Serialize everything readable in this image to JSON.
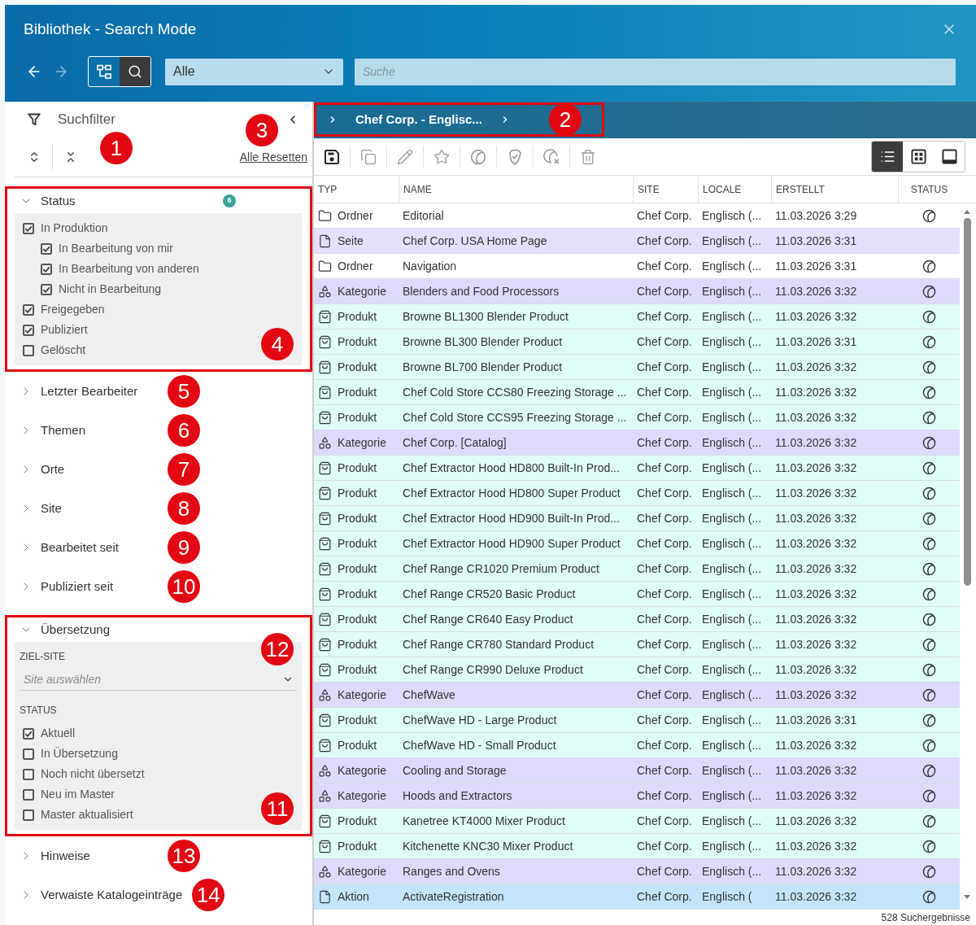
{
  "window": {
    "title": "Bibliothek - Search Mode"
  },
  "header": {
    "nav": [
      {
        "kind": "back",
        "disabled": false
      },
      {
        "kind": "forward",
        "disabled": true
      }
    ],
    "modes": [
      {
        "kind": "tree",
        "selected": false
      },
      {
        "kind": "search",
        "selected": true
      }
    ],
    "scope": {
      "value": "Alle"
    },
    "search": {
      "placeholder": "Suche"
    }
  },
  "filter_panel": {
    "title": "Suchfilter",
    "tools_callout": "1",
    "reset_link": "Alle Resetten",
    "reset_callout": "3",
    "sections": [
      {
        "title": "Status",
        "expanded": true,
        "highlighted": true,
        "badge": "6",
        "callout": "4",
        "options": [
          {
            "label": "In Produktion",
            "checked": true,
            "children": [
              {
                "label": "In Bearbeitung von mir",
                "checked": true
              },
              {
                "label": "In Bearbeitung von anderen",
                "checked": true
              },
              {
                "label": "Nicht in Bearbeitung",
                "checked": true
              }
            ]
          },
          {
            "label": "Freigegeben",
            "checked": true
          },
          {
            "label": "Publiziert",
            "checked": true
          },
          {
            "label": "Gelöscht",
            "checked": false
          }
        ]
      },
      {
        "title": "Letzter Bearbeiter",
        "expanded": false,
        "highlighted": false,
        "callout": "5"
      },
      {
        "title": "Themen",
        "expanded": false,
        "highlighted": false,
        "callout": "6"
      },
      {
        "title": "Orte",
        "expanded": false,
        "highlighted": false,
        "callout": "7"
      },
      {
        "title": "Site",
        "expanded": false,
        "highlighted": false,
        "callout": "8"
      },
      {
        "title": "Bearbeitet seit",
        "expanded": false,
        "highlighted": false,
        "callout": "9"
      },
      {
        "title": "Publiziert seit",
        "expanded": false,
        "highlighted": false,
        "callout": "10"
      },
      {
        "title": "Übersetzung",
        "expanded": true,
        "highlighted": true,
        "target_site": {
          "label": "ZIEL-SITE",
          "placeholder": "Site auswählen",
          "callout": "12"
        },
        "status_label": "STATUS",
        "callout": "11",
        "options": [
          {
            "label": "Aktuell",
            "checked": true
          },
          {
            "label": "In Übersetzung",
            "checked": false
          },
          {
            "label": "Noch nicht übersetzt",
            "checked": false
          },
          {
            "label": "Neu im Master",
            "checked": false
          },
          {
            "label": "Master aktualisiert",
            "checked": false
          }
        ]
      },
      {
        "title": "Hinweise",
        "expanded": false,
        "highlighted": false,
        "callout": "13"
      },
      {
        "title": "Verwaiste Katalogeinträge",
        "expanded": false,
        "highlighted": false,
        "callout": "14"
      }
    ]
  },
  "breadcrumb": {
    "items": [
      "Chef Corp. - Englisc..."
    ],
    "highlighted": true,
    "callout": "2"
  },
  "item_toolbar": {
    "actions": [
      {
        "kind": "save",
        "disabled": false
      },
      {
        "kind": "copy",
        "disabled": true
      },
      {
        "kind": "edit",
        "disabled": true
      },
      {
        "kind": "favorite",
        "disabled": true
      },
      {
        "kind": "publish",
        "disabled": true
      },
      {
        "kind": "approve",
        "disabled": true
      },
      {
        "kind": "withdraw",
        "disabled": true
      },
      {
        "kind": "delete",
        "disabled": true
      }
    ],
    "views": [
      {
        "kind": "list",
        "selected": true
      },
      {
        "kind": "grid",
        "selected": false
      },
      {
        "kind": "preview",
        "selected": false
      }
    ]
  },
  "table": {
    "columns": [
      "TYP",
      "NAME",
      "SITE",
      "LOCALE",
      "ERSTELLT",
      "STATUS"
    ],
    "rows": [
      {
        "kind": "folder",
        "type": "Ordner",
        "name": "Editorial",
        "site": "Chef Corp.",
        "locale": "Englisch (...",
        "created": "11.03.2026 3:29",
        "published": true
      },
      {
        "kind": "page",
        "type": "Seite",
        "name": "Chef Corp. USA Home Page",
        "site": "Chef Corp.",
        "locale": "Englisch (...",
        "created": "11.03.2026 3:31",
        "published": false
      },
      {
        "kind": "folder",
        "type": "Ordner",
        "name": "Navigation",
        "site": "Chef Corp.",
        "locale": "Englisch (...",
        "created": "11.03.2026 3:31",
        "published": true
      },
      {
        "kind": "category",
        "type": "Kategorie",
        "name": "Blenders and Food Processors",
        "site": "Chef Corp.",
        "locale": "Englisch (...",
        "created": "11.03.2026 3:32",
        "published": true
      },
      {
        "kind": "product",
        "type": "Produkt",
        "name": "Browne BL1300 Blender Product",
        "site": "Chef Corp.",
        "locale": "Englisch (...",
        "created": "11.03.2026 3:32",
        "published": true
      },
      {
        "kind": "product",
        "type": "Produkt",
        "name": "Browne BL300 Blender Product",
        "site": "Chef Corp.",
        "locale": "Englisch (...",
        "created": "11.03.2026 3:31",
        "published": true
      },
      {
        "kind": "product",
        "type": "Produkt",
        "name": "Browne BL700 Blender Product",
        "site": "Chef Corp.",
        "locale": "Englisch (...",
        "created": "11.03.2026 3:32",
        "published": true
      },
      {
        "kind": "product",
        "type": "Produkt",
        "name": "Chef Cold Store CCS80 Freezing Storage ...",
        "site": "Chef Corp.",
        "locale": "Englisch (...",
        "created": "11.03.2026 3:32",
        "published": true
      },
      {
        "kind": "product",
        "type": "Produkt",
        "name": "Chef Cold Store CCS95 Freezing Storage ...",
        "site": "Chef Corp.",
        "locale": "Englisch (...",
        "created": "11.03.2026 3:32",
        "published": true
      },
      {
        "kind": "category",
        "type": "Kategorie",
        "name": "Chef Corp. [Catalog]",
        "site": "Chef Corp.",
        "locale": "Englisch (...",
        "created": "11.03.2026 3:32",
        "published": true
      },
      {
        "kind": "product",
        "type": "Produkt",
        "name": "Chef Extractor Hood HD800 Built-In Prod...",
        "site": "Chef Corp.",
        "locale": "Englisch (...",
        "created": "11.03.2026 3:32",
        "published": true
      },
      {
        "kind": "product",
        "type": "Produkt",
        "name": "Chef Extractor Hood HD800 Super Product",
        "site": "Chef Corp.",
        "locale": "Englisch (...",
        "created": "11.03.2026 3:32",
        "published": true
      },
      {
        "kind": "product",
        "type": "Produkt",
        "name": "Chef Extractor Hood HD900 Built-In Prod...",
        "site": "Chef Corp.",
        "locale": "Englisch (...",
        "created": "11.03.2026 3:32",
        "published": true
      },
      {
        "kind": "product",
        "type": "Produkt",
        "name": "Chef Extractor Hood HD900 Super Product",
        "site": "Chef Corp.",
        "locale": "Englisch (...",
        "created": "11.03.2026 3:32",
        "published": true
      },
      {
        "kind": "product",
        "type": "Produkt",
        "name": "Chef Range CR1020 Premium Product",
        "site": "Chef Corp.",
        "locale": "Englisch (...",
        "created": "11.03.2026 3:32",
        "published": true
      },
      {
        "kind": "product",
        "type": "Produkt",
        "name": "Chef Range CR520 Basic Product",
        "site": "Chef Corp.",
        "locale": "Englisch (...",
        "created": "11.03.2026 3:32",
        "published": true
      },
      {
        "kind": "product",
        "type": "Produkt",
        "name": "Chef Range CR640 Easy Product",
        "site": "Chef Corp.",
        "locale": "Englisch (...",
        "created": "11.03.2026 3:32",
        "published": true
      },
      {
        "kind": "product",
        "type": "Produkt",
        "name": "Chef Range CR780 Standard Product",
        "site": "Chef Corp.",
        "locale": "Englisch (...",
        "created": "11.03.2026 3:32",
        "published": true
      },
      {
        "kind": "product",
        "type": "Produkt",
        "name": "Chef Range CR990 Deluxe Product",
        "site": "Chef Corp.",
        "locale": "Englisch (...",
        "created": "11.03.2026 3:32",
        "published": true
      },
      {
        "kind": "category",
        "type": "Kategorie",
        "name": "ChefWave",
        "site": "Chef Corp.",
        "locale": "Englisch (...",
        "created": "11.03.2026 3:32",
        "published": true
      },
      {
        "kind": "product",
        "type": "Produkt",
        "name": "ChefWave HD - Large Product",
        "site": "Chef Corp.",
        "locale": "Englisch (...",
        "created": "11.03.2026 3:31",
        "published": true
      },
      {
        "kind": "product",
        "type": "Produkt",
        "name": "ChefWave HD - Small Product",
        "site": "Chef Corp.",
        "locale": "Englisch (...",
        "created": "11.03.2026 3:32",
        "published": true
      },
      {
        "kind": "category",
        "type": "Kategorie",
        "name": "Cooling and Storage",
        "site": "Chef Corp.",
        "locale": "Englisch (...",
        "created": "11.03.2026 3:32",
        "published": true
      },
      {
        "kind": "category",
        "type": "Kategorie",
        "name": "Hoods and Extractors",
        "site": "Chef Corp.",
        "locale": "Englisch (...",
        "created": "11.03.2026 3:32",
        "published": true
      },
      {
        "kind": "product",
        "type": "Produkt",
        "name": "Kanetree KT4000 Mixer Product",
        "site": "Chef Corp.",
        "locale": "Englisch (...",
        "created": "11.03.2026 3:32",
        "published": true
      },
      {
        "kind": "product",
        "type": "Produkt",
        "name": "Kitchenette KNC30 Mixer Product",
        "site": "Chef Corp.",
        "locale": "Englisch (...",
        "created": "11.03.2026 3:32",
        "published": true
      },
      {
        "kind": "category",
        "type": "Kategorie",
        "name": "Ranges and Ovens",
        "site": "Chef Corp.",
        "locale": "Englisch (...",
        "created": "11.03.2026 3:32",
        "published": true
      },
      {
        "kind": "action",
        "type": "Aktion",
        "name": "ActivateRegistration",
        "site": "Chef Corp.",
        "locale": "Englisch (",
        "created": "11.03.2026 3:32",
        "published": true
      }
    ]
  },
  "status_bar": {
    "result_count": "528 Suchergebnisse"
  }
}
